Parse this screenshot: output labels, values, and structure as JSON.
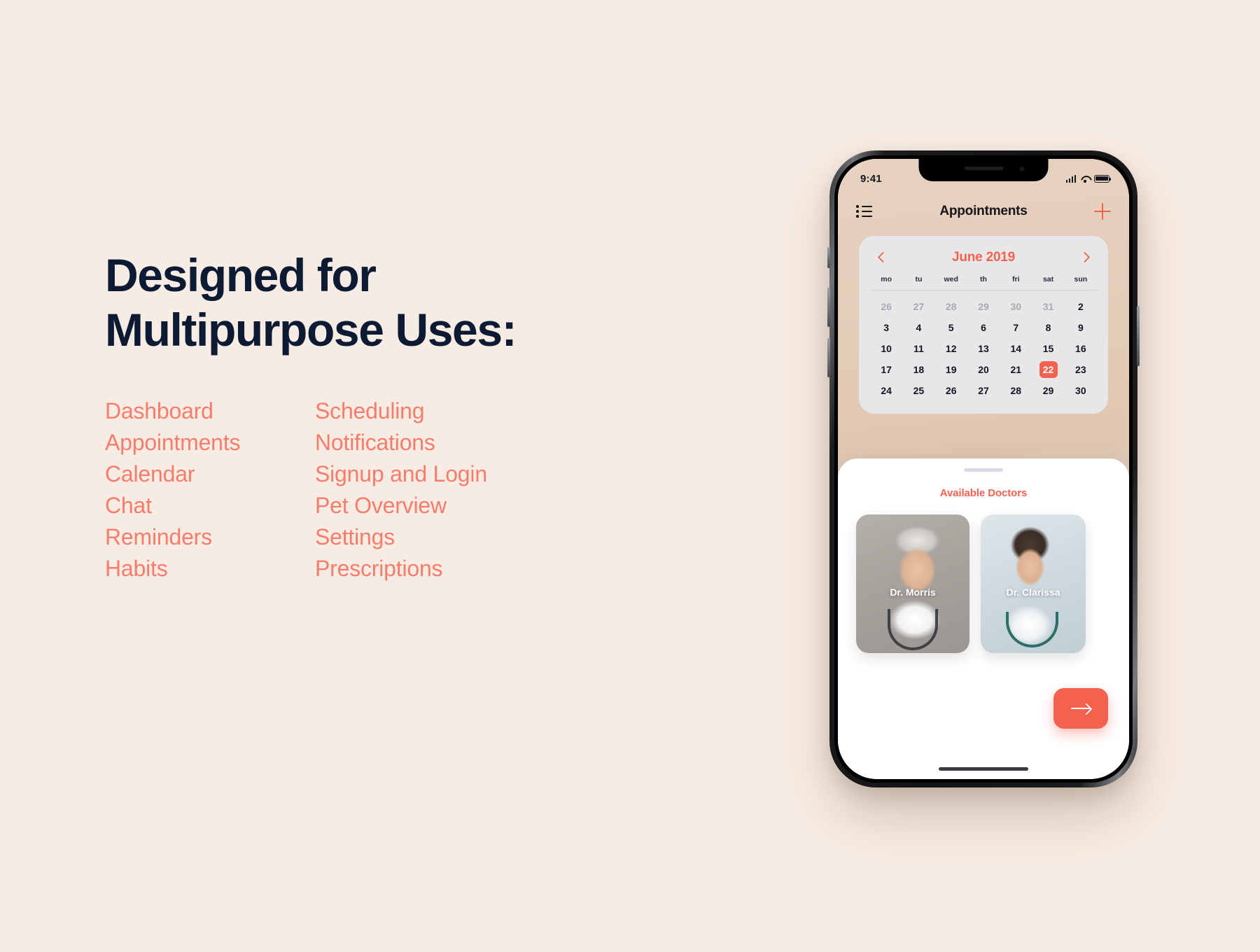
{
  "page": {
    "background_color": "#f7ece3",
    "headline_lines": [
      "Designed for",
      "Multipurpose Uses:"
    ],
    "headline_color": "#0d1a33",
    "accent_color": "#f87c6c"
  },
  "features": {
    "column_one": [
      "Dashboard",
      "Appointments",
      "Calendar",
      "Chat",
      "Reminders",
      "Habits"
    ],
    "column_two": [
      "Scheduling",
      "Notifications",
      "Signup and Login",
      "Pet Overview",
      "Settings",
      "Prescriptions"
    ]
  },
  "phone": {
    "status_bar": {
      "time": "9:41",
      "signal_icon": "cellular-bars-icon",
      "wifi_icon": "wifi-icon",
      "battery_icon": "battery-icon"
    },
    "header": {
      "menu_icon": "list-bullet-icon",
      "title": "Appointments",
      "add_icon": "plus-icon",
      "accent_color": "#f4614f"
    },
    "calendar": {
      "prev_icon": "chevron-left-icon",
      "month_label": "June 2019",
      "next_icon": "chevron-right-icon",
      "weekdays": [
        "mo",
        "tu",
        "wed",
        "th",
        "fri",
        "sat",
        "sun"
      ],
      "selected_date": "22",
      "weeks": [
        [
          {
            "d": "26",
            "muted": true
          },
          {
            "d": "27",
            "muted": true
          },
          {
            "d": "28",
            "muted": true
          },
          {
            "d": "29",
            "muted": true
          },
          {
            "d": "30",
            "muted": true
          },
          {
            "d": "31",
            "muted": true
          },
          {
            "d": "2",
            "muted": false
          }
        ],
        [
          {
            "d": "3",
            "muted": false
          },
          {
            "d": "4",
            "muted": false
          },
          {
            "d": "5",
            "muted": false
          },
          {
            "d": "6",
            "muted": false
          },
          {
            "d": "7",
            "muted": false
          },
          {
            "d": "8",
            "muted": false
          },
          {
            "d": "9",
            "muted": false
          }
        ],
        [
          {
            "d": "10",
            "muted": false
          },
          {
            "d": "11",
            "muted": false
          },
          {
            "d": "12",
            "muted": false
          },
          {
            "d": "13",
            "muted": false
          },
          {
            "d": "14",
            "muted": false
          },
          {
            "d": "15",
            "muted": false
          },
          {
            "d": "16",
            "muted": false
          }
        ],
        [
          {
            "d": "17",
            "muted": false
          },
          {
            "d": "18",
            "muted": false
          },
          {
            "d": "19",
            "muted": false
          },
          {
            "d": "20",
            "muted": false
          },
          {
            "d": "21",
            "muted": false
          },
          {
            "d": "22",
            "muted": false,
            "selected": true
          },
          {
            "d": "23",
            "muted": false
          }
        ],
        [
          {
            "d": "24",
            "muted": false
          },
          {
            "d": "25",
            "muted": false
          },
          {
            "d": "26",
            "muted": false
          },
          {
            "d": "27",
            "muted": false
          },
          {
            "d": "28",
            "muted": false
          },
          {
            "d": "29",
            "muted": false
          },
          {
            "d": "30",
            "muted": false
          }
        ]
      ]
    },
    "sheet": {
      "title": "Available Doctors",
      "doctors": [
        {
          "name": "Dr. Morris"
        },
        {
          "name": "Dr. Clarissa"
        }
      ],
      "next_button_icon": "arrow-right-icon"
    }
  }
}
